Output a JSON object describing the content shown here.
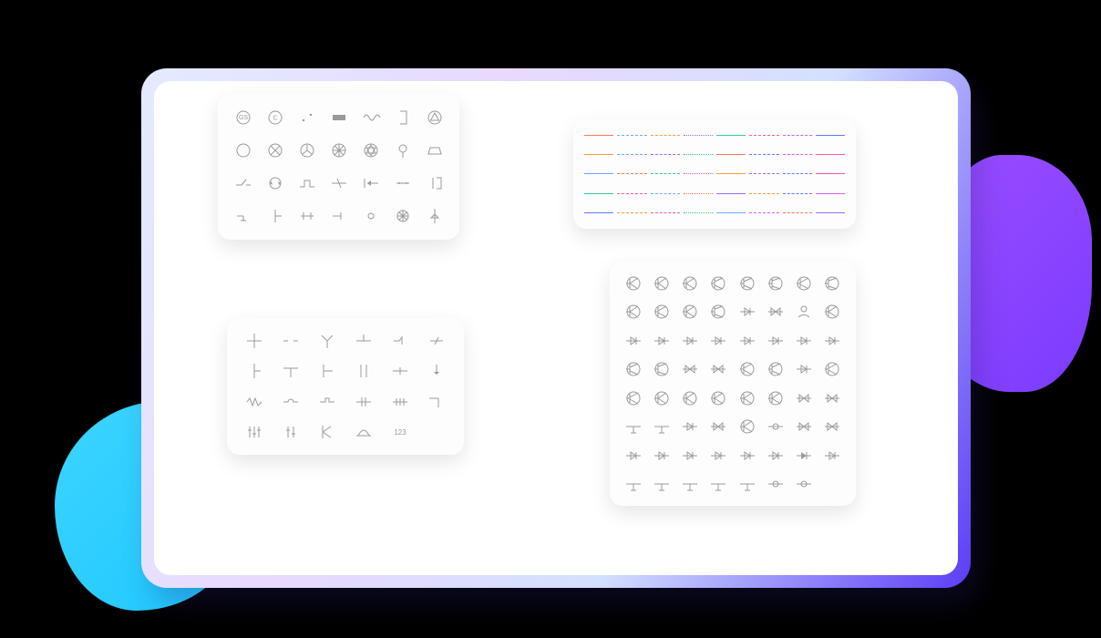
{
  "decorative_blobs": {
    "cyan_color": "#1ec8ff",
    "purple_color": "#7b3bff"
  },
  "panels": {
    "top_left": {
      "name": "electrical-source-shapes",
      "rows": 4,
      "cols": 7,
      "shapes": [
        "gs-circle",
        "c-circle",
        "dot-pair",
        "solid-rect",
        "sine-wave",
        "right-bracket",
        "triangle-in-circle",
        "circle",
        "circle-x",
        "three-phase",
        "circle-x-big",
        "star-of-david",
        "ring-stem",
        "trapezoid",
        "switch-open",
        "rotate-arrows",
        "step-line",
        "crossed-stem",
        "arrow-left-stem",
        "line-dots",
        "capacitor-flag",
        "ground-tap",
        "t-junction",
        "h-terminal",
        "stub-terminal",
        "node-dot",
        "wheel",
        "vertical-diode"
      ]
    },
    "top_right": {
      "name": "line-style-swatches",
      "rows": 5,
      "cols": 8,
      "styles_cycle": [
        "solid",
        "dashed",
        "dashed",
        "dotted",
        "solid",
        "dashed",
        "dashed",
        "solid"
      ],
      "colors": [
        [
          "#ff7a59",
          "#6fa8ff",
          "#ff9a3d",
          "#9b6bff",
          "#3ac6a0",
          "#ff5c8a",
          "#d15cff",
          "#5c7bff"
        ],
        [
          "#ff9a3d",
          "#6fa8ff",
          "#9b6bff",
          "#3ac6a0",
          "#ff7a59",
          "#5c7bff",
          "#d15cff",
          "#ff5c8a"
        ],
        [
          "#6fa8ff",
          "#ff7a59",
          "#3ac6a0",
          "#d15cff",
          "#ff9a3d",
          "#9b6bff",
          "#5c7bff",
          "#ff5c8a"
        ],
        [
          "#3ac6a0",
          "#ff5c8a",
          "#6fa8ff",
          "#ff7a59",
          "#9b6bff",
          "#ff9a3d",
          "#5c7bff",
          "#d15cff"
        ],
        [
          "#5c7bff",
          "#ff9a3d",
          "#ff5c8a",
          "#3ac6a0",
          "#6fa8ff",
          "#d15cff",
          "#ff7a59",
          "#9b6bff"
        ]
      ]
    },
    "bottom_left": {
      "name": "connection-shapes",
      "rows": 4,
      "cols": 6,
      "text_cell_label": "123",
      "shapes": [
        "crossing",
        "double-gap",
        "fork-up",
        "t-split",
        "kink-stub",
        "slash-stem",
        "vertical-tap",
        "tee-down",
        "offset-tap",
        "double-vertical",
        "center-tap",
        "probe-down",
        "zigzag-line",
        "hump-line",
        "notch-line",
        "double-bar",
        "triple-bar",
        "drop-line",
        "triple-stagger",
        "double-stagger",
        "k-junction",
        "loop",
        "numeric-label",
        "blank"
      ]
    },
    "bottom_right": {
      "name": "semiconductor-shapes",
      "rows": 8,
      "cols": 8,
      "shapes": [
        "npn",
        "pnp",
        "photo-trans",
        "fet-n",
        "fet-p",
        "igbt",
        "mosfet",
        "jfet",
        "jk-flip",
        "bjt-circle",
        "scr",
        "opto",
        "photo-diode-c",
        "triac",
        "avatar",
        "fet-alt",
        "diode-right",
        "diode-left",
        "diode-up",
        "led",
        "zener",
        "tunnel",
        "schottky",
        "varactor",
        "thyristor",
        "gate-scr",
        "diac",
        "triac-alt",
        "bridge",
        "clamp",
        "switch-diode",
        "buffer",
        "y-junction",
        "y-split",
        "k-trans",
        "x-trans",
        "crossed",
        "d-trans",
        "bowtie",
        "hourglass",
        "tap-left",
        "tap-right",
        "bi-diode",
        "anti-parallel",
        "series-pair",
        "ring-pair",
        "back2back",
        "spark-gap",
        "inline-diode",
        "inline-led",
        "inline-zener",
        "inline-cap",
        "inline-res",
        "inline-fuse",
        "inline-filled",
        "inline-open",
        "ground-device",
        "tee-device",
        "y-device",
        "cross-device",
        "loop-device",
        "ring-device",
        "dot-device",
        "blank"
      ]
    }
  }
}
